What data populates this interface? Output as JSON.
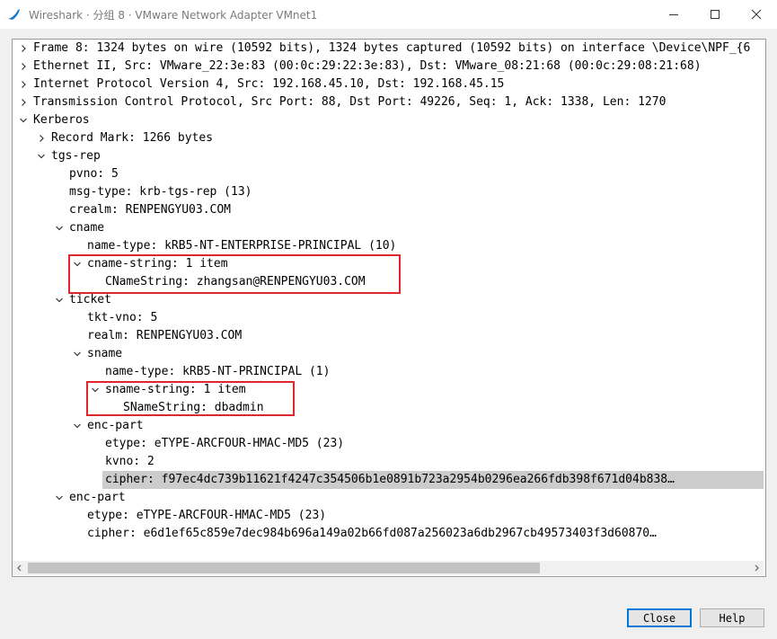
{
  "window": {
    "title": "Wireshark · 分组 8 · VMware Network Adapter VMnet1",
    "controls": [
      "minimize-icon",
      "maximize-icon",
      "close-icon"
    ]
  },
  "tree": {
    "rows": [
      {
        "text": "Frame 8: 1324 bytes on wire (10592 bits), 1324 bytes captured (10592 bits) on interface \\Device\\NPF_{6",
        "level": 0,
        "state": "collapsed"
      },
      {
        "text": "Ethernet II, Src: VMware_22:3e:83 (00:0c:29:22:3e:83), Dst: VMware_08:21:68 (00:0c:29:08:21:68)",
        "level": 0,
        "state": "collapsed"
      },
      {
        "text": "Internet Protocol Version 4, Src: 192.168.45.10, Dst: 192.168.45.15",
        "level": 0,
        "state": "collapsed"
      },
      {
        "text": "Transmission Control Protocol, Src Port: 88, Dst Port: 49226, Seq: 1, Ack: 1338, Len: 1270",
        "level": 0,
        "state": "collapsed"
      },
      {
        "text": "Kerberos",
        "level": 0,
        "state": "expanded"
      },
      {
        "text": "Record Mark: 1266 bytes",
        "level": 1,
        "state": "collapsed"
      },
      {
        "text": "tgs-rep",
        "level": 1,
        "state": "expanded"
      },
      {
        "text": "pvno: 5",
        "level": 2,
        "state": "leaf"
      },
      {
        "text": "msg-type: krb-tgs-rep (13)",
        "level": 2,
        "state": "leaf"
      },
      {
        "text": "crealm: RENPENGYU03.COM",
        "level": 2,
        "state": "leaf"
      },
      {
        "text": "cname",
        "level": 2,
        "state": "expanded"
      },
      {
        "text": "name-type: kRB5-NT-ENTERPRISE-PRINCIPAL (10)",
        "level": 3,
        "state": "leaf"
      },
      {
        "text": "cname-string: 1 item",
        "level": 3,
        "state": "expanded"
      },
      {
        "text": "CNameString: zhangsan@RENPENGYU03.COM",
        "level": 4,
        "state": "leaf"
      },
      {
        "text": "ticket",
        "level": 2,
        "state": "expanded"
      },
      {
        "text": "tkt-vno: 5",
        "level": 3,
        "state": "leaf"
      },
      {
        "text": "realm: RENPENGYU03.COM",
        "level": 3,
        "state": "leaf"
      },
      {
        "text": "sname",
        "level": 3,
        "state": "expanded"
      },
      {
        "text": "name-type: kRB5-NT-PRINCIPAL (1)",
        "level": 4,
        "state": "leaf"
      },
      {
        "text": "sname-string: 1 item",
        "level": 4,
        "state": "expanded"
      },
      {
        "text": "SNameString: dbadmin",
        "level": 5,
        "state": "leaf"
      },
      {
        "text": "enc-part",
        "level": 3,
        "state": "expanded"
      },
      {
        "text": "etype: eTYPE-ARCFOUR-HMAC-MD5 (23)",
        "level": 4,
        "state": "leaf"
      },
      {
        "text": "kvno: 2",
        "level": 4,
        "state": "leaf"
      },
      {
        "text": "cipher: f97ec4dc739b11621f4247c354506b1e0891b723a2954b0296ea266fdb398f671d04b838…",
        "level": 4,
        "state": "leaf",
        "selected": true
      },
      {
        "text": "enc-part",
        "level": 2,
        "state": "expanded"
      },
      {
        "text": "etype: eTYPE-ARCFOUR-HMAC-MD5 (23)",
        "level": 3,
        "state": "leaf"
      },
      {
        "text": "cipher: e6d1ef65c859e7dec984b696a149a02b66fd087a256023a6db2967cb49573403f3d60870…",
        "level": 3,
        "state": "leaf"
      }
    ]
  },
  "highlight_color": "#e0262b",
  "selection_color": "#cccccc",
  "buttons": {
    "close_label": "Close",
    "help_label": "Help"
  }
}
